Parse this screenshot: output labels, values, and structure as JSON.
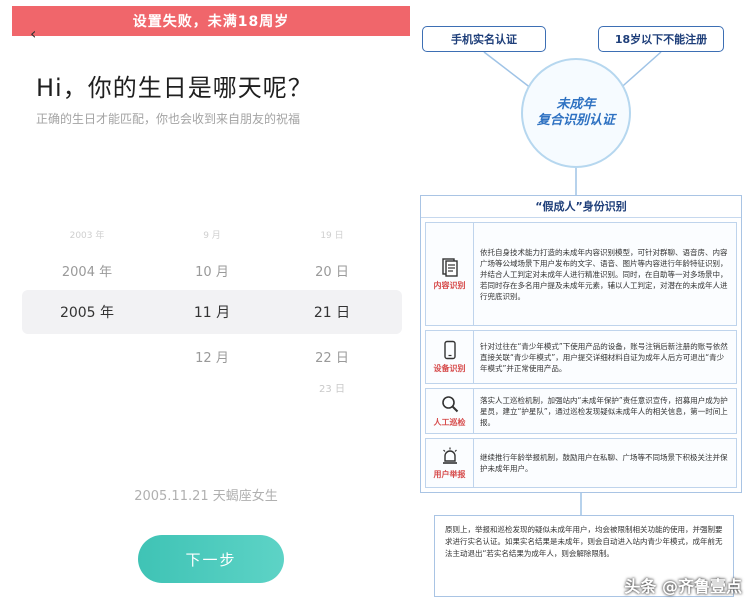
{
  "phone": {
    "toast": "设置失败，未满18周岁",
    "title": "Hi，你的生日是哪天呢？",
    "subtitle": "正确的生日才能匹配，你也会收到来自朋友的祝福",
    "picker": {
      "year": [
        "2003 年",
        "2004 年",
        "2005 年",
        "",
        ""
      ],
      "month": [
        "9 月",
        "10 月",
        "11 月",
        "12 月",
        ""
      ],
      "day": [
        "19 日",
        "20 日",
        "21 日",
        "22 日",
        "23 日"
      ]
    },
    "summary": "2005.11.21 天蝎座女生",
    "next_button": "下一步"
  },
  "diagram": {
    "tag_left": "手机实名认证",
    "tag_right": "18岁以下不能注册",
    "hub_line1": "未成年",
    "hub_line2": "复合识别认证",
    "main_title": "“假成人”身份识别",
    "rows": [
      {
        "icon": "document-icon",
        "label": "内容识别",
        "text": "依托自身技术能力打造的未成年内容识别模型，可针对群聊、语音房、内容广场等公域场景下用户发布的文字、语音、图片等内容进行年龄特征识别，并结合人工判定对未成年人进行精准识别。同时，在自助等一对多场景中，若同时存在多名用户提及未成年元素，辅以人工判定，对潜在的未成年人进行兜底识别。"
      },
      {
        "icon": "phone-icon",
        "label": "设备识别",
        "text": "针对过往在“青少年模式”下使用产品的设备，账号注销后新注册的账号依然直接关联“青少年模式”，用户提交详细材料自证为成年人后方可退出“青少年模式”并正常使用产品。"
      },
      {
        "icon": "search-icon",
        "label": "人工巡检",
        "text": "落实人工巡检机制，加强站内“未成年保护”责任意识宣传，招募用户成为护星员，建立“护星队”，通过巡检发现疑似未成年人的相关信息，第一时间上报。"
      },
      {
        "icon": "alarm-icon",
        "label": "用户举报",
        "text": "继续推行年龄举报机制，鼓励用户在私聊、广场等不同场景下积极关注并保护未成年用户。"
      }
    ],
    "bottom_text": "原则上，举报和巡检发现的疑似未成年用户，均会被限制相关功能的使用，并强制要求进行实名认证。如果实名结果是未成年，则会自动进入站内青少年模式，成年前无法主动退出“若实名结果为成年人，则会解除限制。",
    "watermark": "头条 @齐鲁壹点"
  },
  "colors": {
    "toast_bg": "#f0666b",
    "button_teal": "#3fc3b5",
    "diagram_blue": "#3d6fb4",
    "label_red": "#d64b4b"
  }
}
